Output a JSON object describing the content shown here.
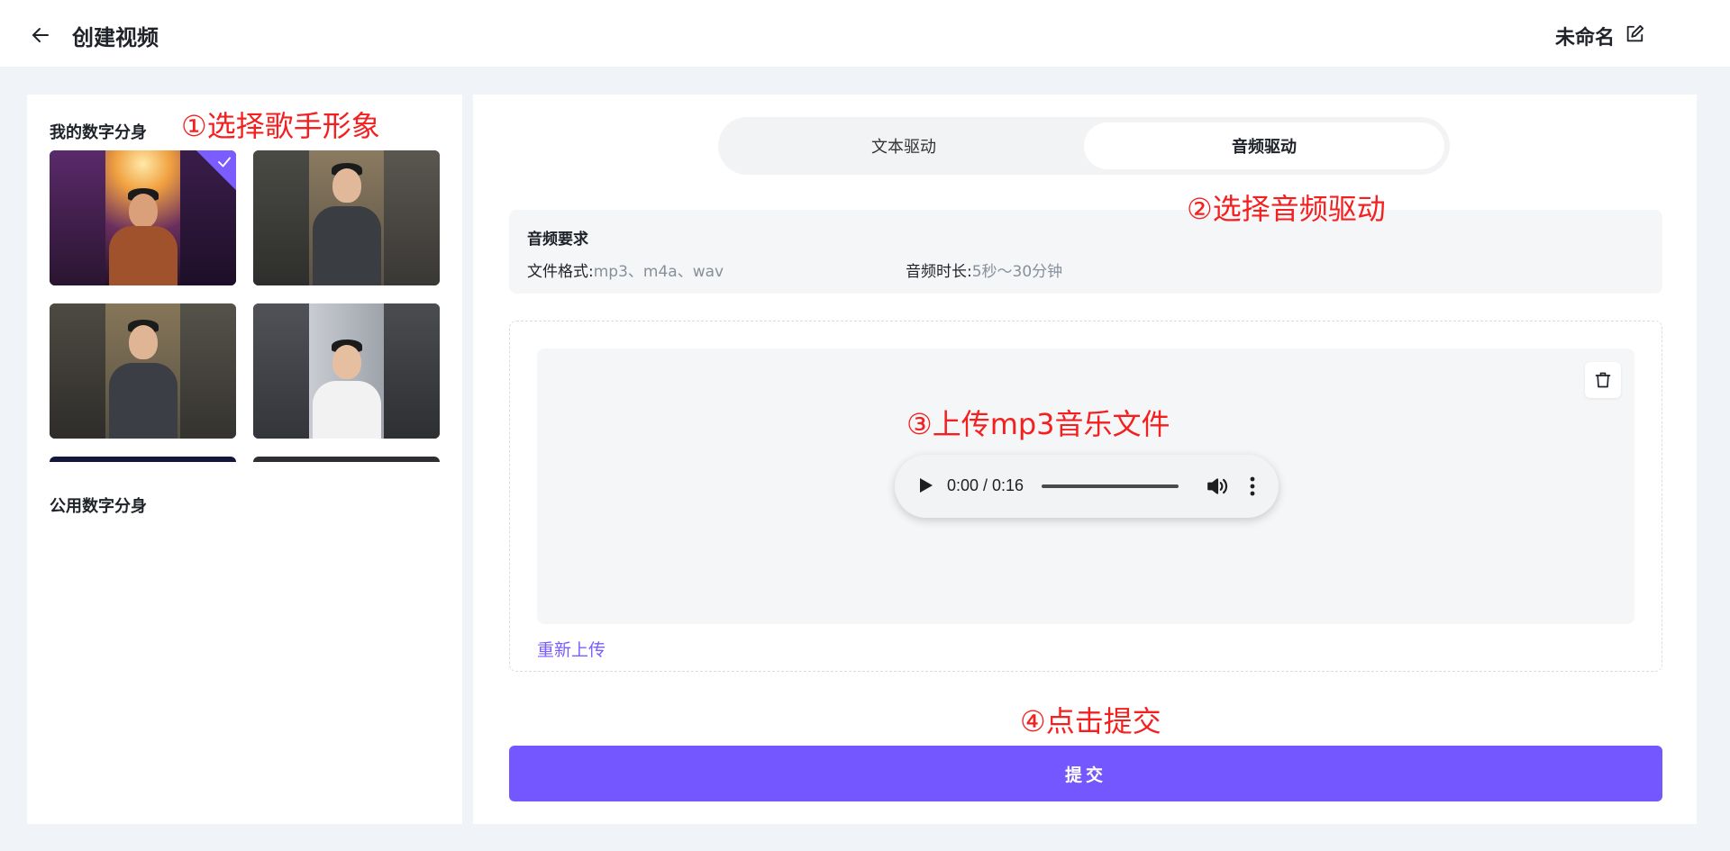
{
  "header": {
    "title": "创建视频",
    "project_name": "未命名",
    "back_icon": "arrow-left-icon",
    "edit_icon": "edit-icon"
  },
  "left_panel": {
    "my_avatars_title": "我的数字分身",
    "public_avatars_title": "公用数字分身",
    "avatars": [
      {
        "label": "singer-on-stage",
        "selected": true
      },
      {
        "label": "man-in-office-gesturing",
        "selected": false
      },
      {
        "label": "man-in-office-explaining",
        "selected": false
      },
      {
        "label": "man-seated-white-shirt",
        "selected": false
      }
    ]
  },
  "mode_switch": {
    "text_mode": "文本驱动",
    "audio_mode": "音频驱动",
    "active": "audio"
  },
  "requirements": {
    "title": "音频要求",
    "format_label": "文件格式:",
    "format_value": "mp3、m4a、wav",
    "duration_label": "音频时长:",
    "duration_value": "5秒～30分钟"
  },
  "audio_player": {
    "time": "0:00 / 0:16",
    "progress_fraction": 0.0
  },
  "upload": {
    "reupload_label": "重新上传",
    "delete_icon": "trash-icon"
  },
  "submit_label": "提交",
  "annotations": {
    "step1": "①选择歌手形象",
    "step2": "②选择音频驱动",
    "step3": "③上传mp3音乐文件",
    "step4": "④点击提交"
  },
  "colors": {
    "accent": "#7457fe",
    "link": "#7b5cff",
    "annotation": "#f42020"
  }
}
